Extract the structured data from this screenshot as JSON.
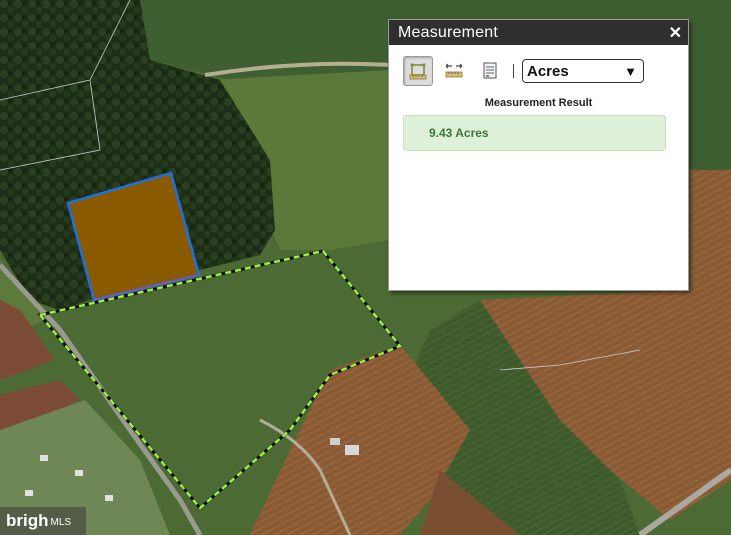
{
  "panel": {
    "title": "Measurement",
    "close_label": "✕",
    "tools": [
      {
        "icon": "measure-area-icon",
        "active": true
      },
      {
        "icon": "measure-distance-icon",
        "active": false
      },
      {
        "icon": "location-icon",
        "active": false
      }
    ],
    "separator": "|",
    "unit_select": {
      "selected": "Acres",
      "caret": "▼"
    },
    "result_heading": "Measurement Result",
    "result_value": "9.43 Acres"
  },
  "watermark": {
    "brand": "brigh",
    "suffix": "MLS"
  },
  "colors": {
    "measured_parcel_fill": "#8a5a00",
    "measured_parcel_stroke": "#1f6fe0",
    "property_boundary": "#9af04a",
    "result_bg": "#dff0d8",
    "result_text": "#3c763d"
  }
}
